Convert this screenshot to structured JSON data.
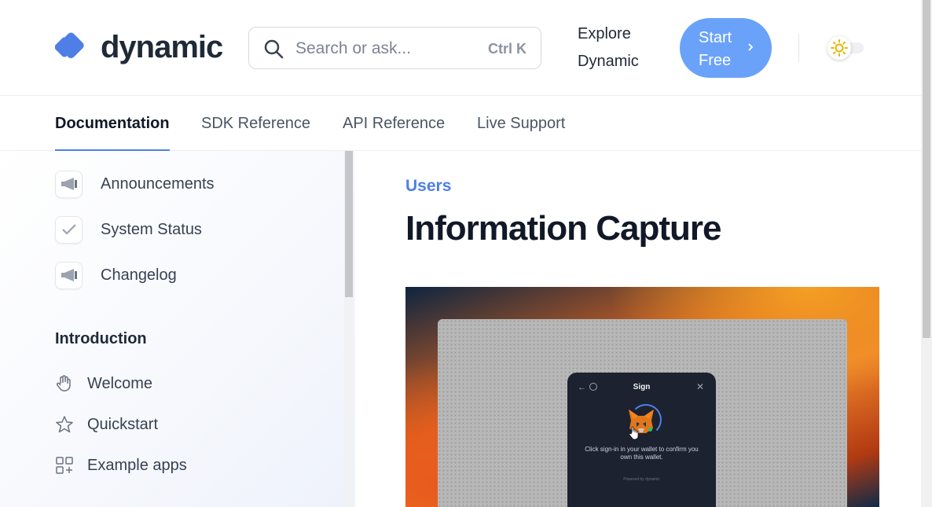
{
  "header": {
    "logo_text": "dynamic",
    "search": {
      "placeholder": "Search or ask...",
      "shortcut": "Ctrl K"
    },
    "explore_label": "Explore Dynamic",
    "start_label": "Start Free",
    "brand_color": "#4f7fe6",
    "button_color": "#6aa2fa"
  },
  "tabs": [
    {
      "label": "Documentation",
      "active": true
    },
    {
      "label": "SDK Reference",
      "active": false
    },
    {
      "label": "API Reference",
      "active": false
    },
    {
      "label": "Live Support",
      "active": false
    }
  ],
  "sidebar": {
    "top_items": [
      {
        "label": "Announcements",
        "icon": "megaphone-icon"
      },
      {
        "label": "System Status",
        "icon": "check-icon"
      },
      {
        "label": "Changelog",
        "icon": "megaphone-icon"
      }
    ],
    "section_title": "Introduction",
    "section_items": [
      {
        "label": "Welcome",
        "icon": "waving-hand-icon"
      },
      {
        "label": "Quickstart",
        "icon": "star-icon"
      },
      {
        "label": "Example apps",
        "icon": "grid-plus-icon"
      }
    ]
  },
  "main": {
    "breadcrumb": "Users",
    "title": "Information Capture",
    "hero_modal": {
      "title": "Sign",
      "message": "Click sign-in in your wallet to confirm you own this wallet.",
      "footer": "Powered by dynamic"
    }
  }
}
